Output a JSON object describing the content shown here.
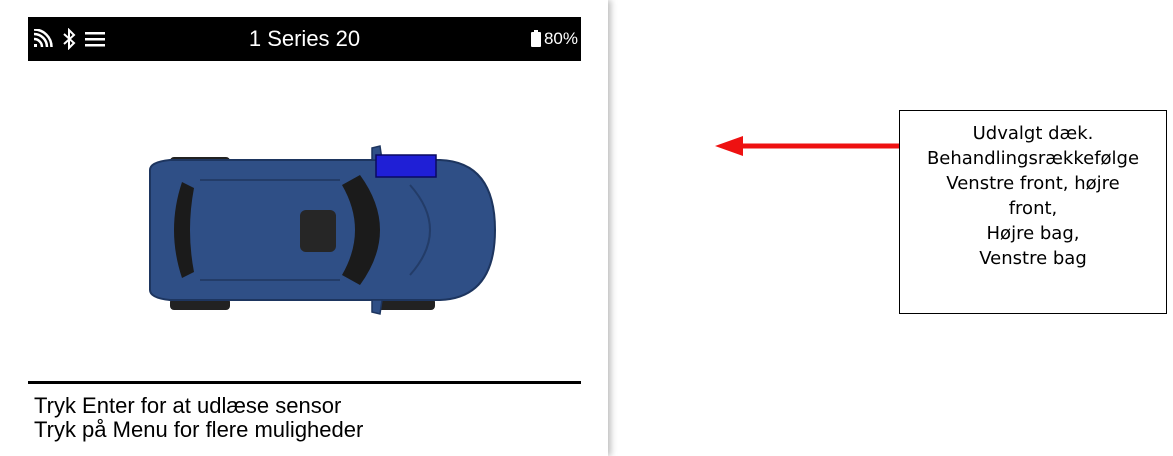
{
  "device": {
    "status_icons": [
      "signal-icon",
      "bluetooth-icon",
      "menu-icon"
    ],
    "title": "1 Series 20",
    "battery_text": "80%",
    "selected_tyre": "front-right",
    "instructions": [
      "Tryk Enter for at udlæse sensor",
      "Tryk på Menu for flere muligheder"
    ],
    "colors": {
      "car_body": "#2f4f86",
      "selected_marker": "#1f1fd6"
    }
  },
  "annotation": {
    "arrow_color": "#ee1111",
    "lines": [
      "Udvalgt dæk.",
      "Behandlingsrækkefølge",
      "Venstre front, højre",
      "front,",
      "Højre bag,",
      "Venstre bag"
    ]
  }
}
